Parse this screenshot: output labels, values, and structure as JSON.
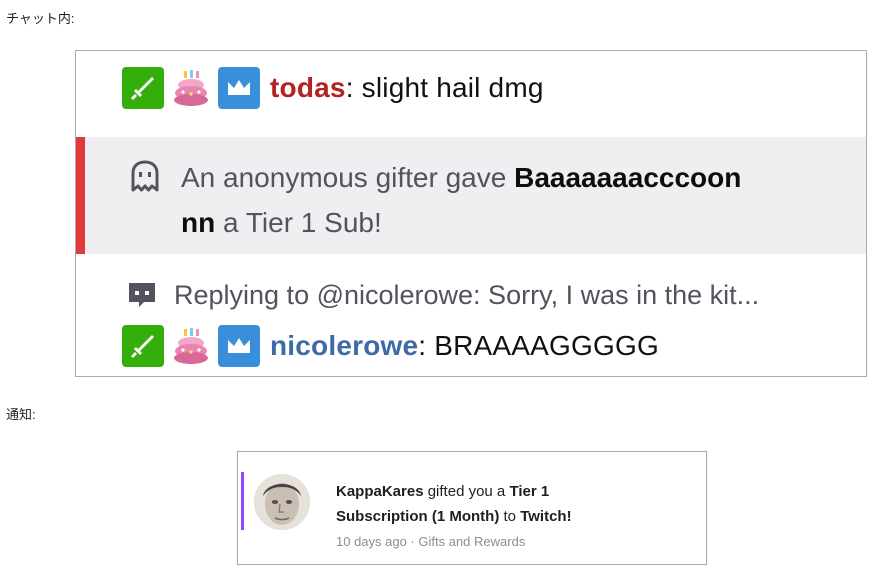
{
  "labels": {
    "chat": "チャット内:",
    "notification": "通知:"
  },
  "chat": {
    "message1": {
      "badges": [
        "moderator-sword-icon",
        "cake-badge-icon",
        "subscriber-crown-icon"
      ],
      "username": "todas",
      "username_color": "#b22222",
      "separator": ":",
      "text": " slight hail dmg"
    },
    "sub_notice": {
      "icon": "ghost-icon",
      "accent_color": "#e03a3a",
      "prefix": "An anonymous gifter gave ",
      "recipient": "Baaaaaaacccoonnn",
      "recipient_line1": "Baaaaaaacccoon",
      "recipient_line2": "nn",
      "suffix": " a Tier 1 Sub!"
    },
    "reply": {
      "icon": "reply-chat-icon",
      "text": "Replying to @nicolerowe: Sorry, I was in the kit..."
    },
    "message2": {
      "badges": [
        "moderator-sword-icon",
        "cake-badge-icon",
        "subscriber-crown-icon"
      ],
      "username": "nicolerowe",
      "username_color": "#3e6aa7",
      "separator": ":",
      "text": " BRAAAAGGGGG"
    }
  },
  "notification": {
    "sender": "KappaKares",
    "mid_text": " gifted you a ",
    "bold_item": "Tier 1 Subscription (1 Month)",
    "bold_line1": "Tier 1",
    "bold_line2": "Subscription (1 Month)",
    "to_text": " to ",
    "platform": "Twitch!",
    "meta": "10 days ago · Gifts and Rewards",
    "accent_color": "#9147ff"
  }
}
